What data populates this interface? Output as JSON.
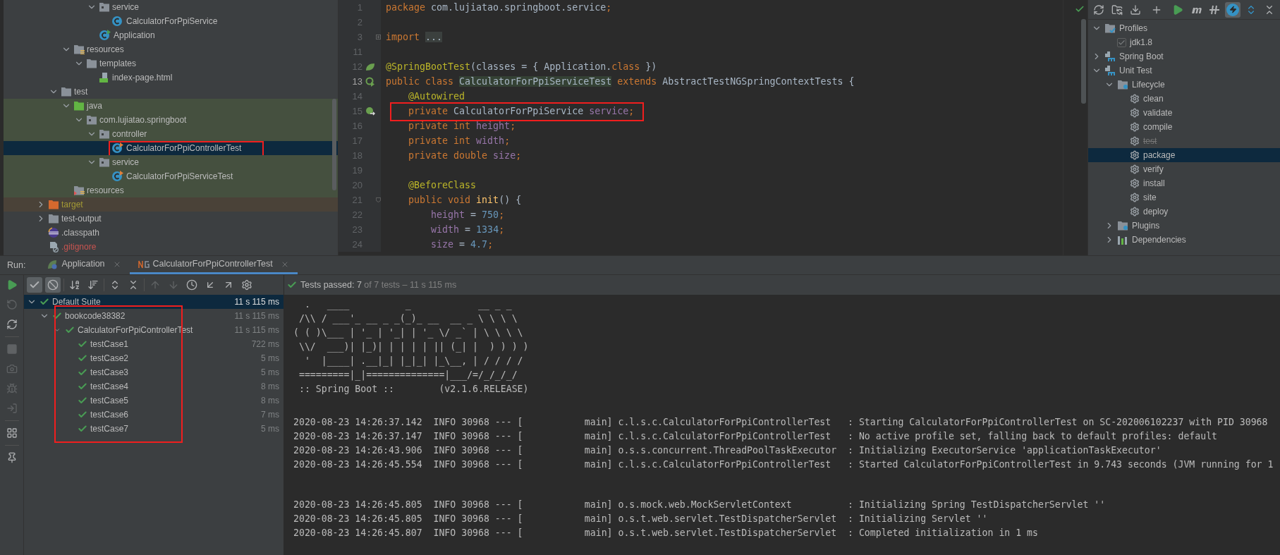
{
  "project_tree": {
    "items": [
      {
        "children": [
          {
            "children": [
              {
                "children": [
                  {
                    "children": [
                      {
                        "label": "service",
                        "kind": "package",
                        "expanded": true,
                        "selected": false,
                        "children": [
                          {
                            "label": "CalculatorForPpiService",
                            "kind": "class",
                            "selected": false
                          }
                        ]
                      },
                      {
                        "label": "Application",
                        "kind": "app-class",
                        "selected": false
                      }
                    ]
                  }
                ]
              },
              {
                "label": "resources",
                "kind": "resources",
                "expanded": true,
                "selected": false,
                "children": [
                  {
                    "label": "templates",
                    "kind": "folder",
                    "expanded": true,
                    "selected": false,
                    "children": [
                      {
                        "label": "index-page.html",
                        "kind": "html",
                        "selected": false
                      }
                    ]
                  }
                ]
              }
            ]
          },
          {
            "label": "test",
            "kind": "folder",
            "expanded": true,
            "selected": false,
            "children": [
              {
                "label": "java",
                "kind": "test-root",
                "expanded": true,
                "test_source": true,
                "selected": false,
                "children": [
                  {
                    "label": "com.lujiatao.springboot",
                    "kind": "package",
                    "expanded": true,
                    "test_source": true,
                    "selected": false,
                    "children": [
                      {
                        "label": "controller",
                        "kind": "package",
                        "expanded": true,
                        "test_source": true,
                        "selected": false,
                        "children": [
                          {
                            "label": "CalculatorForPpiControllerTest",
                            "kind": "test-class",
                            "selected": true,
                            "annotated": true
                          }
                        ]
                      },
                      {
                        "label": "service",
                        "kind": "package",
                        "expanded": true,
                        "test_source": true,
                        "selected": false,
                        "children": [
                          {
                            "label": "CalculatorForPpiServiceTest",
                            "kind": "test-class",
                            "test_source": true,
                            "selected": false
                          }
                        ]
                      }
                    ]
                  }
                ]
              },
              {
                "label": "resources",
                "kind": "test-resources",
                "test_source": true,
                "selected": false
              }
            ]
          }
        ]
      },
      {
        "label": "target",
        "kind": "excluded-folder",
        "expanded": false,
        "excluded": true,
        "color": "#a39a35",
        "selected": false
      },
      {
        "label": "test-output",
        "kind": "folder",
        "expanded": false,
        "selected": false
      },
      {
        "label": ".classpath",
        "kind": "eclipse",
        "selected": false
      },
      {
        "label": ".gitignore",
        "kind": "ignore-file",
        "color": "#c75450",
        "selected": false
      }
    ]
  },
  "editor": {
    "lines": [
      {
        "number": "1",
        "tokens": [
          {
            "text": "package",
            "kind": "keyword"
          },
          {
            "text": " com.lujiatao.springboot.service",
            "kind": "plain"
          },
          {
            "text": ";",
            "kind": "keyword"
          }
        ]
      },
      {
        "number": "2"
      },
      {
        "number": "3",
        "fold": {
          "kind": "collapsed"
        },
        "tokens": [
          {
            "text": "import ",
            "kind": "keyword"
          },
          {
            "text": "...",
            "kind": "folded"
          }
        ]
      },
      {
        "number": "11"
      },
      {
        "number": "12",
        "gutter": {
          "kind": "bean"
        },
        "tokens": [
          {
            "text": "@SpringBootTest",
            "kind": "annotation"
          },
          {
            "text": "(classes = { Application.",
            "kind": "plain"
          },
          {
            "text": "class",
            "kind": "keyword"
          },
          {
            "text": " })",
            "kind": "plain"
          }
        ]
      },
      {
        "number": "13",
        "gutter": {
          "kind": "run"
        },
        "current": true,
        "tokens": [
          {
            "text": "public class ",
            "kind": "keyword"
          },
          {
            "text": "CalculatorForPpiServiceTest",
            "kind": "highlighted"
          },
          {
            "text": " extends ",
            "kind": "keyword"
          },
          {
            "text": "AbstractTestNGSpringContextTests {",
            "kind": "plain"
          }
        ]
      },
      {
        "number": "14",
        "tokens": [
          {
            "text": "    @Autowired",
            "kind": "annotation"
          }
        ]
      },
      {
        "number": "15",
        "gutter": {
          "kind": "autowired"
        },
        "annotated": true,
        "tokens": [
          {
            "text": "    private ",
            "kind": "keyword"
          },
          {
            "text": "CalculatorForPpiService ",
            "kind": "plain"
          },
          {
            "text": "service",
            "kind": "field"
          },
          {
            "text": ";",
            "kind": "keyword"
          }
        ]
      },
      {
        "number": "16",
        "tokens": [
          {
            "text": "    private int ",
            "kind": "keyword"
          },
          {
            "text": "height",
            "kind": "field"
          },
          {
            "text": ";",
            "kind": "keyword"
          }
        ]
      },
      {
        "number": "17",
        "tokens": [
          {
            "text": "    private int ",
            "kind": "keyword"
          },
          {
            "text": "width",
            "kind": "field"
          },
          {
            "text": ";",
            "kind": "keyword"
          }
        ]
      },
      {
        "number": "18",
        "tokens": [
          {
            "text": "    private double ",
            "kind": "keyword"
          },
          {
            "text": "size",
            "kind": "field"
          },
          {
            "text": ";",
            "kind": "keyword"
          }
        ]
      },
      {
        "number": "19"
      },
      {
        "number": "20",
        "tokens": [
          {
            "text": "    @BeforeClass",
            "kind": "annotation"
          }
        ]
      },
      {
        "number": "21",
        "fold": {
          "kind": "expanded"
        },
        "tokens": [
          {
            "text": "    public void ",
            "kind": "keyword"
          },
          {
            "text": "init",
            "kind": "method"
          },
          {
            "text": "() {",
            "kind": "plain"
          }
        ]
      },
      {
        "number": "22",
        "tokens": [
          {
            "text": "        height",
            "kind": "field"
          },
          {
            "text": " = ",
            "kind": "plain"
          },
          {
            "text": "750",
            "kind": "number"
          },
          {
            "text": ";",
            "kind": "keyword"
          }
        ]
      },
      {
        "number": "23",
        "tokens": [
          {
            "text": "        width",
            "kind": "field"
          },
          {
            "text": " = ",
            "kind": "plain"
          },
          {
            "text": "1334",
            "kind": "number"
          },
          {
            "text": ";",
            "kind": "keyword"
          }
        ]
      },
      {
        "number": "24",
        "tokens": [
          {
            "text": "        size",
            "kind": "field"
          },
          {
            "text": " = ",
            "kind": "plain"
          },
          {
            "text": "4.7",
            "kind": "number"
          },
          {
            "text": ";",
            "kind": "keyword"
          }
        ]
      }
    ]
  },
  "maven": {
    "skip_tests_mode": true,
    "items": [
      {
        "label": "Profiles",
        "kind": "profiles",
        "expanded": true,
        "selected": false,
        "children": [
          {
            "label": "jdk1.8",
            "kind": "profile",
            "checked": true,
            "selected": false
          }
        ]
      },
      {
        "label": "Spring Boot",
        "kind": "project",
        "expanded": false,
        "selected": false
      },
      {
        "label": "Unit Test",
        "kind": "project",
        "expanded": true,
        "selected": false,
        "children": [
          {
            "label": "Lifecycle",
            "kind": "lifecycle",
            "expanded": true,
            "selected": false,
            "children": [
              {
                "label": "clean",
                "kind": "goal",
                "skipped": false,
                "selected": false
              },
              {
                "label": "validate",
                "kind": "goal",
                "skipped": false,
                "selected": false
              },
              {
                "label": "compile",
                "kind": "goal",
                "skipped": false,
                "selected": false
              },
              {
                "label": "test",
                "kind": "goal",
                "skipped": true,
                "selected": false
              },
              {
                "label": "package",
                "kind": "goal",
                "skipped": false,
                "selected": true
              },
              {
                "label": "verify",
                "kind": "goal",
                "skipped": false,
                "selected": false
              },
              {
                "label": "install",
                "kind": "goal",
                "skipped": false,
                "selected": false
              },
              {
                "label": "site",
                "kind": "goal",
                "skipped": false,
                "selected": false
              },
              {
                "label": "deploy",
                "kind": "goal",
                "skipped": false,
                "selected": false
              }
            ]
          },
          {
            "label": "Plugins",
            "kind": "plugins",
            "expanded": false,
            "selected": false
          },
          {
            "label": "Dependencies",
            "kind": "dependencies",
            "expanded": false,
            "selected": false
          }
        ]
      }
    ]
  },
  "run": {
    "label": "Run:",
    "tabs": [
      {
        "label": "Application",
        "kind": "app",
        "selected": false
      },
      {
        "label": "CalculatorForPpiControllerTest",
        "kind": "testng",
        "selected": true
      }
    ],
    "filters": {
      "show_passed": true,
      "show_ignored": true
    },
    "summary": {
      "status": "Tests passed: 7",
      "detail": "of 7 tests – 11 s 115 ms"
    },
    "test_tree": [
      {
        "label": "Default Suite",
        "time": "11 s 115 ms",
        "passed": true,
        "expanded": true,
        "selected": true,
        "children": [
          {
            "label": "bookcode38382",
            "time": "11 s 115 ms",
            "passed": true,
            "expanded": true,
            "selected": false,
            "annotated": true,
            "children": [
              {
                "label": "CalculatorForPpiControllerTest",
                "time": "11 s 115 ms",
                "passed": true,
                "expanded": true,
                "selected": false,
                "children": [
                  {
                    "label": "testCase1",
                    "time": "722 ms",
                    "passed": true,
                    "selected": false
                  },
                  {
                    "label": "testCase2",
                    "time": "5 ms",
                    "passed": true,
                    "selected": false
                  },
                  {
                    "label": "testCase3",
                    "time": "5 ms",
                    "passed": true,
                    "selected": false
                  },
                  {
                    "label": "testCase4",
                    "time": "8 ms",
                    "passed": true,
                    "selected": false
                  },
                  {
                    "label": "testCase5",
                    "time": "8 ms",
                    "passed": true,
                    "selected": false
                  },
                  {
                    "label": "testCase6",
                    "time": "7 ms",
                    "passed": true,
                    "selected": false
                  },
                  {
                    "label": "testCase7",
                    "time": "5 ms",
                    "passed": true,
                    "selected": false
                  }
                ]
              }
            ]
          }
        ]
      }
    ],
    "console": {
      "sections": [
        {
          "lines": [
            "  .   ____          _            __ _ _",
            " /\\\\ / ___'_ __ _ _(_)_ __  __ _ \\ \\ \\ \\",
            "( ( )\\___ | '_ | '_| | '_ \\/ _` | \\ \\ \\ \\",
            " \\\\/  ___)| |_)| | | | | || (_| |  ) ) ) )",
            "  '  |____| .__|_| |_|_| |_\\__, | / / / /",
            " =========|_|==============|___/=/_/_/_/",
            " :: Spring Boot ::        (v2.1.6.RELEASE)"
          ]
        },
        {
          "lines": [
            "2020-08-23 14:26:37.142  INFO 30968 --- [           main] c.l.s.c.CalculatorForPpiControllerTest   : Starting CalculatorForPpiControllerTest on SC-202006102237 with PID 30968",
            "2020-08-23 14:26:37.147  INFO 30968 --- [           main] c.l.s.c.CalculatorForPpiControllerTest   : No active profile set, falling back to default profiles: default",
            "2020-08-23 14:26:43.906  INFO 30968 --- [           main] o.s.s.concurrent.ThreadPoolTaskExecutor  : Initializing ExecutorService 'applicationTaskExecutor'",
            "2020-08-23 14:26:45.554  INFO 30968 --- [           main] c.l.s.c.CalculatorForPpiControllerTest   : Started CalculatorForPpiControllerTest in 9.743 seconds (JVM running for 1"
          ]
        },
        {
          "lines": [
            "2020-08-23 14:26:45.805  INFO 30968 --- [           main] o.s.mock.web.MockServletContext          : Initializing Spring TestDispatcherServlet ''",
            "2020-08-23 14:26:45.805  INFO 30968 --- [           main] o.s.t.web.servlet.TestDispatcherServlet  : Initializing Servlet ''",
            "2020-08-23 14:26:45.807  INFO 30968 --- [           main] o.s.t.web.servlet.TestDispatcherServlet  : Completed initialization in 1 ms"
          ]
        }
      ]
    }
  }
}
